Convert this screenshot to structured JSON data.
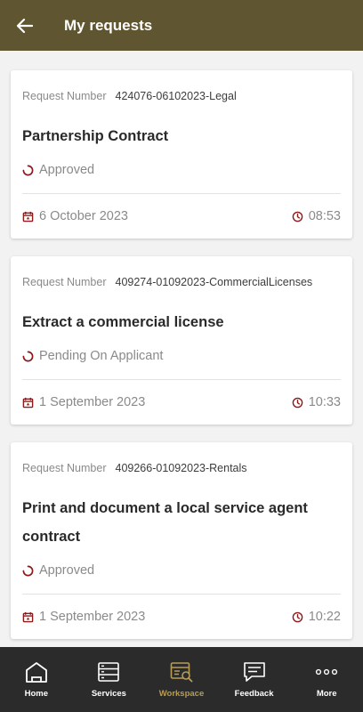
{
  "header": {
    "title": "My requests"
  },
  "colors": {
    "appbar": "#5f5530",
    "accent": "#b79d55",
    "status_icon": "#8b1a1a",
    "nav_bg": "#2b2b2b"
  },
  "requests": [
    {
      "number_label": "Request Number",
      "number": "424076-06102023-Legal",
      "title": "Partnership Contract",
      "status": "Approved",
      "date": "6 October 2023",
      "time": "08:53"
    },
    {
      "number_label": "Request Number",
      "number": "409274-01092023-CommercialLicenses",
      "title": "Extract a commercial license",
      "status": "Pending On Applicant",
      "date": "1 September 2023",
      "time": "10:33"
    },
    {
      "number_label": "Request Number",
      "number": "409266-01092023-Rentals",
      "title": "Print and document a local service agent contract",
      "status": "Approved",
      "date": "1 September 2023",
      "time": "10:22"
    }
  ],
  "nav": [
    {
      "label": "Home",
      "icon": "home-icon"
    },
    {
      "label": "Services",
      "icon": "services-icon"
    },
    {
      "label": "Workspace",
      "icon": "workspace-icon",
      "active": true
    },
    {
      "label": "Feedback",
      "icon": "feedback-icon"
    },
    {
      "label": "More",
      "icon": "more-icon"
    }
  ]
}
